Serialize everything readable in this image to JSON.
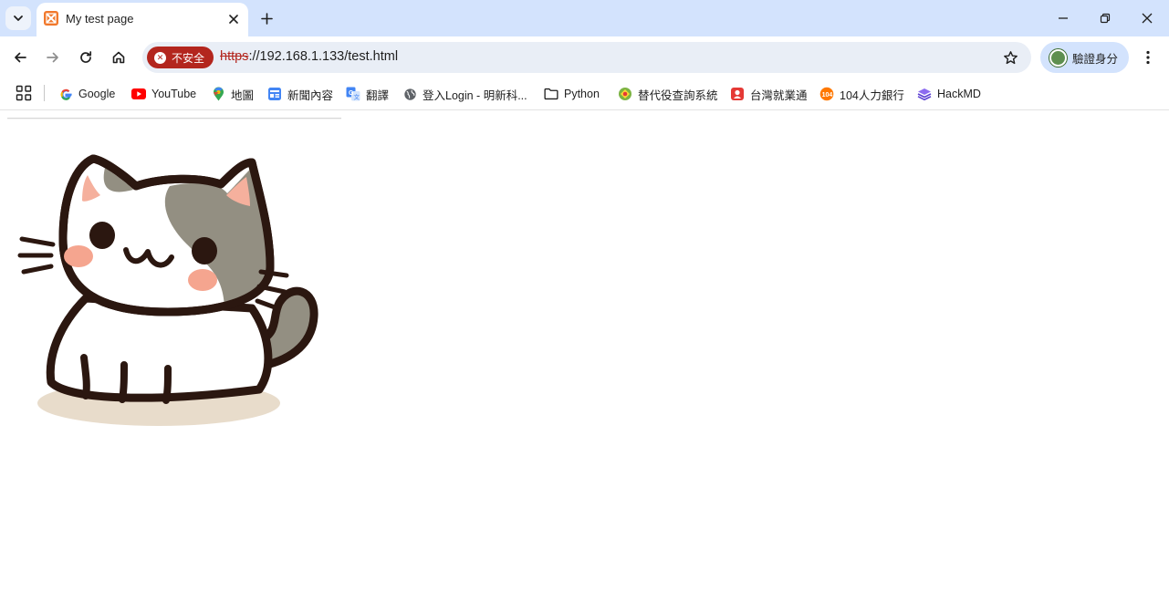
{
  "tab": {
    "title": "My test page"
  },
  "omnibox": {
    "security_label": "不安全",
    "url_scheme": "https",
    "url_rest": "://192.168.1.133/test.html"
  },
  "profile": {
    "label": "驗證身分"
  },
  "bookmarks": [
    {
      "label": "Google",
      "icon": "google-icon"
    },
    {
      "label": "YouTube",
      "icon": "youtube-icon"
    },
    {
      "label": "地圖",
      "icon": "maps-icon"
    },
    {
      "label": "新聞內容",
      "icon": "news-icon"
    },
    {
      "label": "翻譯",
      "icon": "translate-icon"
    },
    {
      "label": "登入Login - 明新科...",
      "icon": "globe-icon"
    },
    {
      "label": "Python",
      "icon": "folder-icon"
    },
    {
      "label": "替代役查詢系統",
      "icon": "site-icon"
    },
    {
      "label": "台灣就業通",
      "icon": "site-icon"
    },
    {
      "label": "104人力銀行",
      "icon": "site-icon"
    },
    {
      "label": "HackMD",
      "icon": "hackmd-icon"
    }
  ],
  "colors": {
    "tabstrip": "#d3e3fd",
    "omnibox": "#e9eef6",
    "insecure": "#b3261e"
  }
}
